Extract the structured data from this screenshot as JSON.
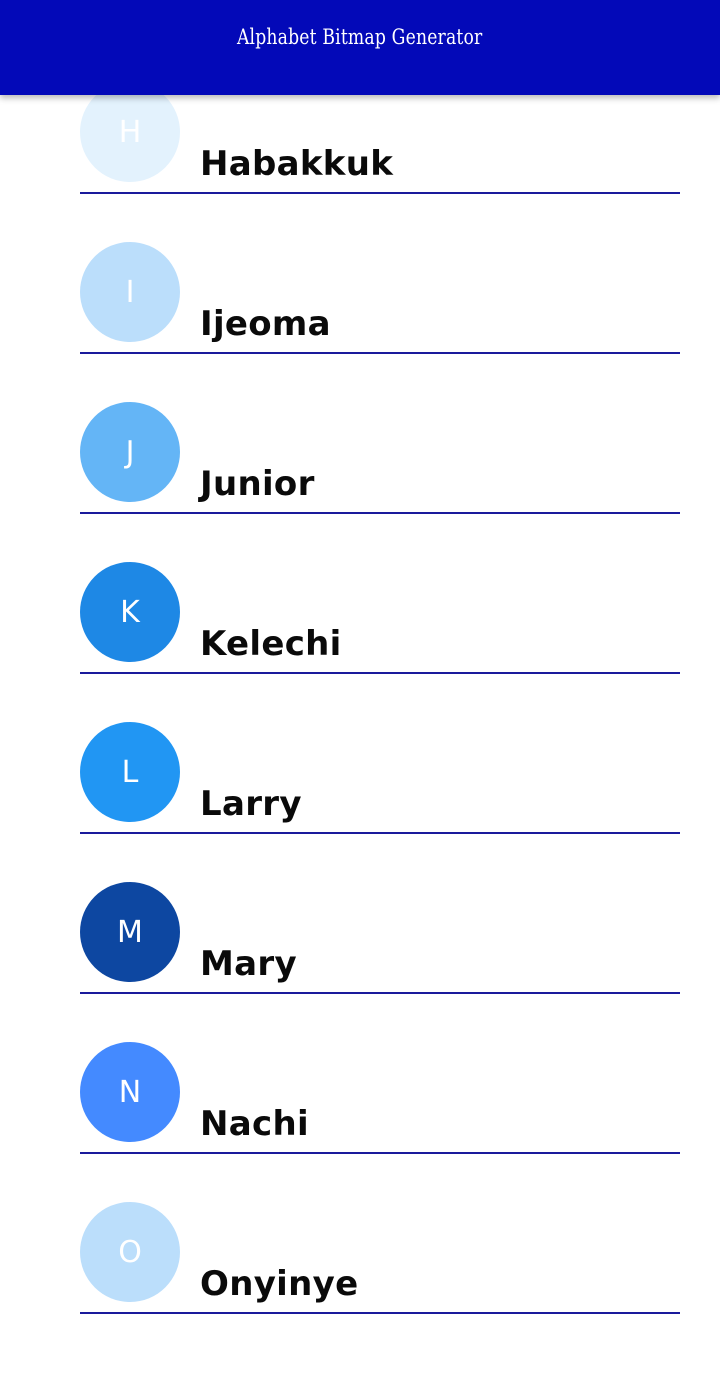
{
  "app_bar": {
    "title": "Alphabet Bitmap Generator",
    "color": "#0309b8"
  },
  "divider_color": "#1a1a9c",
  "contacts": [
    {
      "initial": "H",
      "name": "Habakkuk",
      "color": "#e3f2fd"
    },
    {
      "initial": "I",
      "name": "Ijeoma",
      "color": "#bbdefb"
    },
    {
      "initial": "J",
      "name": "Junior",
      "color": "#64b5f6"
    },
    {
      "initial": "K",
      "name": "Kelechi",
      "color": "#1e88e5"
    },
    {
      "initial": "L",
      "name": "Larry",
      "color": "#2196f3"
    },
    {
      "initial": "M",
      "name": "Mary",
      "color": "#0d47a1"
    },
    {
      "initial": "N",
      "name": "Nachi",
      "color": "#448aff"
    },
    {
      "initial": "O",
      "name": "Onyinye",
      "color": "#bbdefb"
    }
  ]
}
